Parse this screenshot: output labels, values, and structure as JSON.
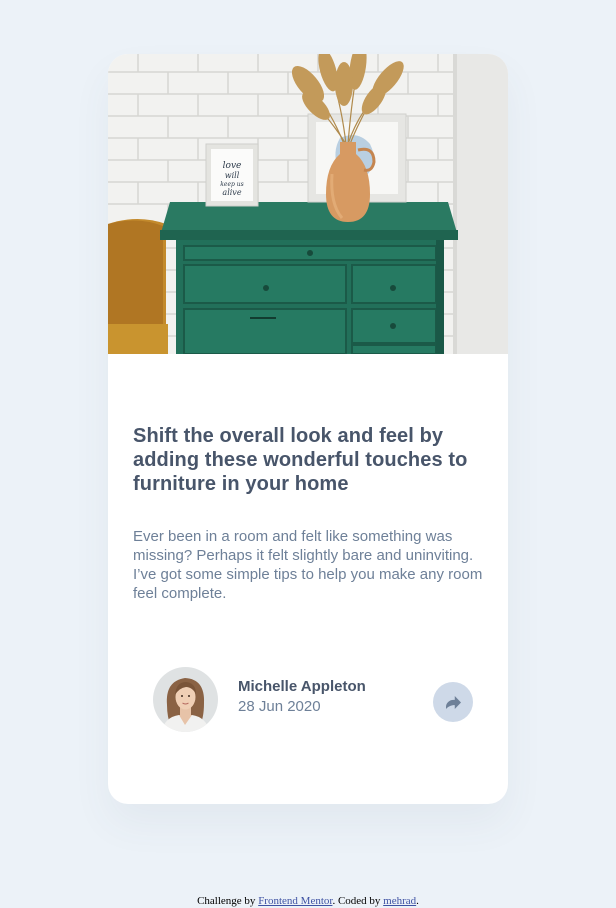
{
  "article": {
    "image_alt": "Green drawer cabinet with a vase of dried grass and a framed print against a white brick wall",
    "title": "Shift the overall look and feel by adding these wonderful touches to furniture in your home",
    "description": "Ever been in a room and felt like something was missing? Perhaps it felt slightly bare and uninviting. I’ve got some simple tips to help you make any room feel complete.",
    "frame_text": "love will keep us alive"
  },
  "author": {
    "name": "Michelle Appleton",
    "date": "28 Jun 2020"
  },
  "share": {
    "icon": "share-icon"
  },
  "attribution": {
    "prefix": "Challenge by ",
    "challenge_link": "Frontend Mentor",
    "middle": ". Coded by ",
    "coder_link": "mehrad",
    "suffix": "."
  },
  "colors": {
    "page_background": "#ecf2f8",
    "card_background": "#ffffff",
    "heading": "#48556a",
    "body_text": "#6e8098",
    "share_button": "#ced9e8",
    "link": "#3e52a3"
  }
}
